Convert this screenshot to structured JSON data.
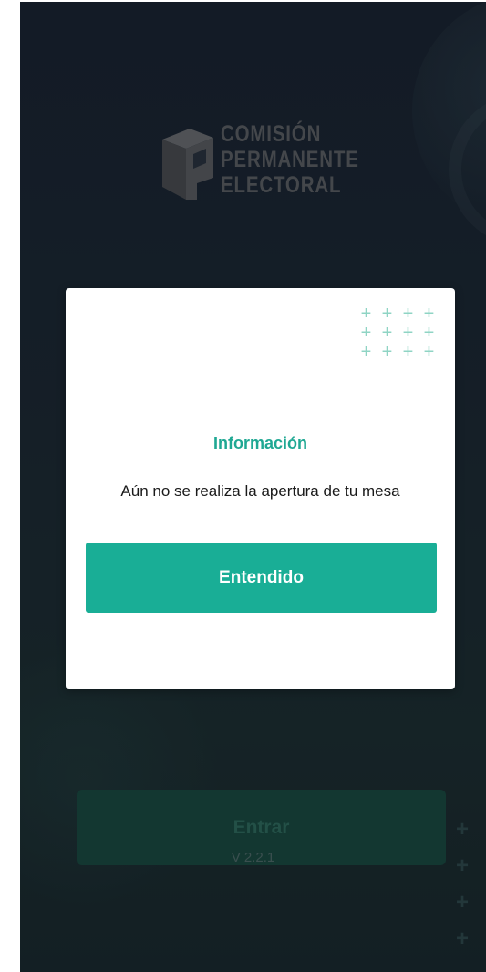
{
  "logo": {
    "lines": [
      "COMISIÓN",
      "PERMANENTE",
      "ELECTORAL"
    ],
    "icon": "cube-logo-icon"
  },
  "login": {
    "button_label": "Entrar",
    "version": "V 2.2.1"
  },
  "dialog": {
    "title": "Información",
    "message": "Aún no se realiza la apertura de tu mesa",
    "confirm_label": "Entendido",
    "decoration": "plus-pattern-icon",
    "accent_color": "#1fa893",
    "button_color": "#19ae96"
  },
  "colors": {
    "background_dark": "#1a2433",
    "login_button": "#1a4a42"
  }
}
